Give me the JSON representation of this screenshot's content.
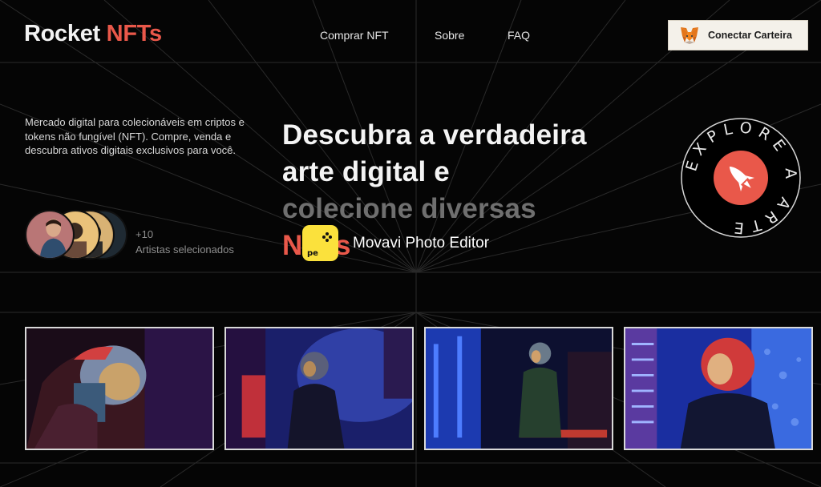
{
  "header": {
    "logo_main": "Rocket",
    "logo_accent": "NFTs",
    "nav": [
      {
        "label": "Comprar NFT"
      },
      {
        "label": "Sobre"
      },
      {
        "label": "FAQ"
      }
    ],
    "wallet_button": "Conectar Carteira",
    "wallet_icon": "metamask-fox-icon"
  },
  "hero": {
    "intro": "Mercado digital para colecionáveis em criptos e tokens não fungível (NFT). Compre, venda e descubra ativos digitais exclusivos para você.",
    "headline_line1": "Descubra a verdadeira",
    "headline_line2": "arte digital e",
    "headline_line3": "colecione diversas",
    "headline_line4": "NFTs",
    "artists_count": "+10",
    "artists_label": "Artistas selecionados",
    "badge_text": "EXPLORE A ARTE",
    "badge_icon": "rocket-icon"
  },
  "watermark": {
    "app_name": "Movavi Photo Editor",
    "icon_label": "pe"
  },
  "gallery": [
    {
      "name": "astronaut-red-helmet"
    },
    {
      "name": "astronaut-blue-smoke"
    },
    {
      "name": "astronaut-neon-corridor"
    },
    {
      "name": "astronaut-red-visor"
    }
  ],
  "colors": {
    "accent": "#e9584a",
    "background": "#050505",
    "button_bg": "#f4f1ea",
    "watermark_yellow": "#fbe13c"
  }
}
